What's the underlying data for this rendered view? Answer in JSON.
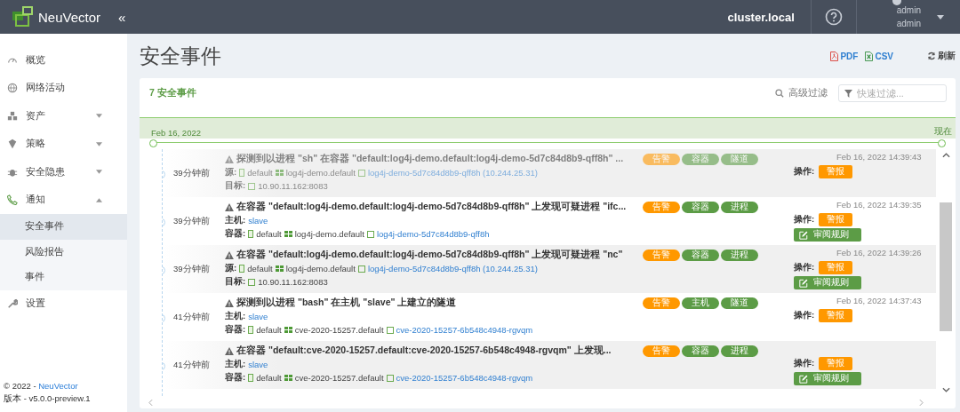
{
  "header": {
    "brand": "NeuVector",
    "collapse": "«",
    "cluster": "cluster.local",
    "user": {
      "name": "admin",
      "role": "admin"
    }
  },
  "sidebar": {
    "items": [
      {
        "label": "概览",
        "selected": false
      },
      {
        "label": "网络活动",
        "selected": false
      },
      {
        "label": "资产",
        "selected": false,
        "expanded": false
      },
      {
        "label": "策略",
        "selected": false,
        "expanded": false
      },
      {
        "label": "安全隐患",
        "selected": false,
        "expanded": false
      },
      {
        "label": "通知",
        "selected": false,
        "expanded": true,
        "children": [
          {
            "label": "安全事件",
            "selected": true
          },
          {
            "label": "风险报告",
            "selected": false
          },
          {
            "label": "事件",
            "selected": false
          }
        ]
      },
      {
        "label": "设置",
        "selected": false
      }
    ],
    "footer": {
      "copyright": "© 2022 -",
      "link": "NeuVector",
      "version": "版本 - v5.0.0-preview.1"
    }
  },
  "page": {
    "title": "安全事件",
    "exports": [
      {
        "label": "PDF",
        "kind": "pdf"
      },
      {
        "label": "CSV",
        "kind": "csv"
      }
    ],
    "refresh": "刷新"
  },
  "card": {
    "count": "7 安全事件",
    "advanced_filter": "高级过滤",
    "quick_filter": {
      "placeholder": "快速过滤..."
    },
    "timeline": {
      "start": "Feb 16, 2022",
      "end": "现在"
    },
    "events": [
      {
        "time": "39分钟前",
        "faded": true,
        "title": "探测到以进程 \"sh\" 在容器 \"default:log4j-demo.default:log4j-demo-5d7c84d8b9-qff8h\" ...",
        "tags": [
          {
            "label": "告警",
            "kind": "alert"
          },
          {
            "label": "容器",
            "kind": "category"
          },
          {
            "label": "隧道",
            "kind": "category"
          }
        ],
        "date": "Feb 16, 2022 14:39:43",
        "fields": [
          {
            "label": "源:",
            "items": [
              {
                "kind": "namespace",
                "text": "default",
                "link": false
              },
              {
                "kind": "group",
                "text": "log4j-demo.default",
                "link": false
              },
              {
                "kind": "pod",
                "text": "log4j-demo-5d7c84d8b9-qff8h (10.244.25.31)",
                "link": true
              }
            ]
          },
          {
            "label": "目标:",
            "items": [
              {
                "kind": "pod",
                "text": "10.90.11.162:8083",
                "link": false
              }
            ]
          }
        ],
        "action_label": "操作:",
        "action": "警报"
      },
      {
        "time": "39分钟前",
        "faded": false,
        "title": "在容器 \"default:log4j-demo.default:log4j-demo-5d7c84d8b9-qff8h\" 上发现可疑进程 \"ifc...",
        "tags": [
          {
            "label": "告警",
            "kind": "alert"
          },
          {
            "label": "容器",
            "kind": "category"
          },
          {
            "label": "进程",
            "kind": "category"
          }
        ],
        "date": "Feb 16, 2022 14:39:35",
        "fields": [
          {
            "label": "主机:",
            "items": [
              {
                "kind": "text",
                "text": "slave",
                "link": true
              }
            ]
          },
          {
            "label": "容器:",
            "items": [
              {
                "kind": "namespace",
                "text": "default",
                "link": false
              },
              {
                "kind": "group",
                "text": "log4j-demo.default",
                "link": false
              },
              {
                "kind": "pod",
                "text": "log4j-demo-5d7c84d8b9-qff8h",
                "link": true
              }
            ]
          }
        ],
        "action_label": "操作:",
        "action": "警报",
        "review": "审阅规则"
      },
      {
        "time": "39分钟前",
        "faded": false,
        "title": "在容器 \"default:log4j-demo.default:log4j-demo-5d7c84d8b9-qff8h\" 上发现可疑进程 \"nc\"",
        "tags": [
          {
            "label": "告警",
            "kind": "alert"
          },
          {
            "label": "容器",
            "kind": "category"
          },
          {
            "label": "进程",
            "kind": "category"
          }
        ],
        "date": "Feb 16, 2022 14:39:26",
        "fields": [
          {
            "label": "源:",
            "items": [
              {
                "kind": "namespace",
                "text": "default",
                "link": false
              },
              {
                "kind": "group",
                "text": "log4j-demo.default",
                "link": false
              },
              {
                "kind": "pod",
                "text": "log4j-demo-5d7c84d8b9-qff8h (10.244.25.31)",
                "link": true
              }
            ]
          },
          {
            "label": "目标:",
            "items": [
              {
                "kind": "pod",
                "text": "10.90.11.162:8083",
                "link": false
              }
            ]
          }
        ],
        "action_label": "操作:",
        "action": "警报",
        "review": "审阅规则"
      },
      {
        "time": "41分钟前",
        "faded": false,
        "title": "探测到以进程 \"bash\" 在主机 \"slave\" 上建立的隧道",
        "tags": [
          {
            "label": "告警",
            "kind": "alert"
          },
          {
            "label": "主机",
            "kind": "category"
          },
          {
            "label": "隧道",
            "kind": "category"
          }
        ],
        "date": "Feb 16, 2022 14:37:43",
        "fields": [
          {
            "label": "主机:",
            "items": [
              {
                "kind": "text",
                "text": "slave",
                "link": true
              }
            ]
          },
          {
            "label": "容器:",
            "items": [
              {
                "kind": "namespace",
                "text": "default",
                "link": false
              },
              {
                "kind": "group",
                "text": "cve-2020-15257.default",
                "link": false
              },
              {
                "kind": "pod",
                "text": "cve-2020-15257-6b548c4948-rgvqm",
                "link": true
              }
            ]
          }
        ],
        "action_label": "操作:",
        "action": "警报"
      },
      {
        "time": "41分钟前",
        "faded": false,
        "title": "在容器 \"default:cve-2020-15257.default:cve-2020-15257-6b548c4948-rgvqm\" 上发现...",
        "tags": [
          {
            "label": "告警",
            "kind": "alert"
          },
          {
            "label": "容器",
            "kind": "category"
          },
          {
            "label": "进程",
            "kind": "category"
          }
        ],
        "fields": [
          {
            "label": "主机:",
            "items": [
              {
                "kind": "text",
                "text": "slave",
                "link": true
              }
            ]
          },
          {
            "label": "容器:",
            "items": [
              {
                "kind": "namespace",
                "text": "default",
                "link": false
              },
              {
                "kind": "group",
                "text": "cve-2020-15257.default",
                "link": false
              },
              {
                "kind": "pod",
                "text": "cve-2020-15257-6b548c4948-rgvqm",
                "link": true
              }
            ]
          }
        ],
        "action_label": "操作:",
        "action": "警报",
        "review": "审阅规则"
      }
    ]
  }
}
